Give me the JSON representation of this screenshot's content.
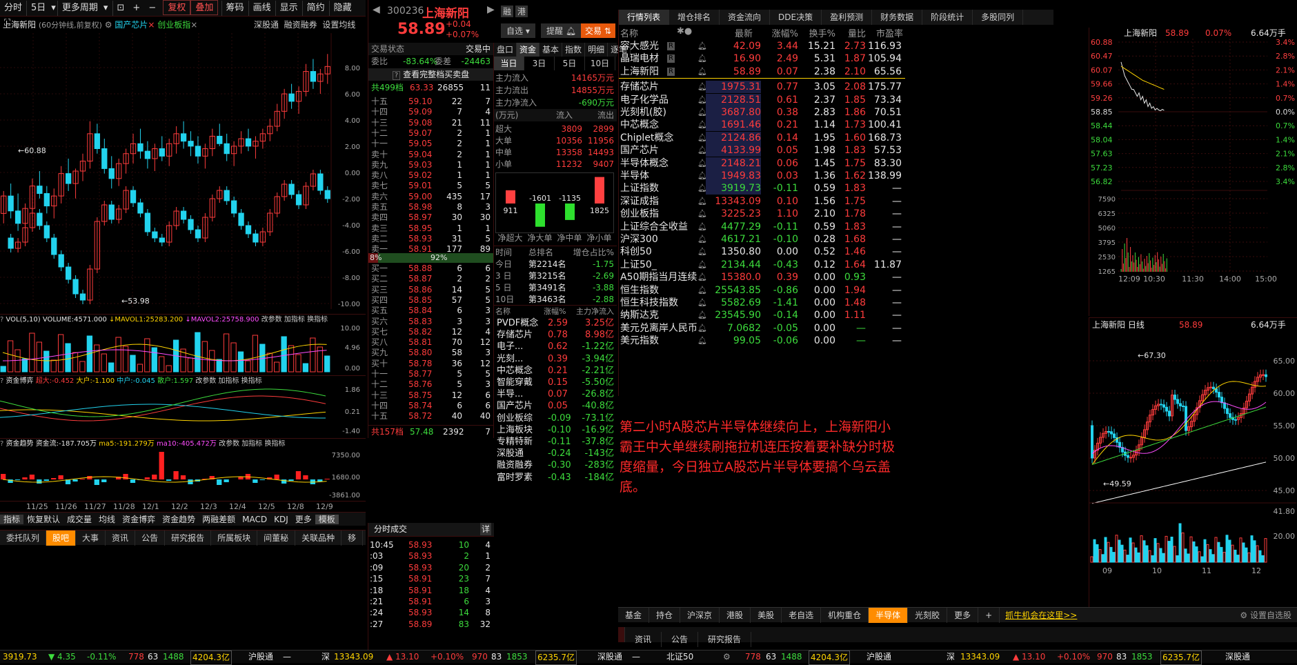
{
  "toolbar": {
    "items": [
      "分时",
      "5日",
      "更多周期",
      "复权",
      "叠加",
      "筹码",
      "画线",
      "显示",
      "简约",
      "隐藏"
    ]
  },
  "chart_header": {
    "stock": "上海新阳",
    "period": "(60分钟线,前复权)",
    "tag1": "国产芯片",
    "tag2": "创业板指",
    "links": [
      "深股通",
      "融资融券",
      "设置均线"
    ]
  },
  "kline": {
    "hi_label": "67.30",
    "lo_label": "53.98",
    "left_hi": "60.88",
    "y_ticks": [
      "8.00",
      "6.00",
      "4.00",
      "2.00",
      "0.00",
      "-2.00",
      "-4.00",
      "-6.00",
      "-8.00",
      "-10.00"
    ],
    "bars": [
      [
        57.2,
        58.1,
        56.8,
        57.9
      ],
      [
        57.9,
        58.4,
        57.0,
        57.3
      ],
      [
        57.3,
        58.0,
        56.5,
        56.8
      ],
      [
        56.8,
        57.6,
        56.3,
        57.4
      ],
      [
        57.4,
        58.6,
        57.1,
        58.3
      ],
      [
        58.3,
        58.9,
        57.8,
        58.0
      ],
      [
        58.0,
        58.3,
        57.2,
        57.5
      ],
      [
        57.5,
        58.2,
        57.0,
        57.9
      ],
      [
        57.9,
        59.1,
        57.6,
        58.8
      ],
      [
        58.8,
        59.4,
        58.1,
        58.4
      ],
      [
        58.4,
        59.0,
        57.8,
        58.9
      ],
      [
        58.9,
        59.6,
        58.5,
        59.3
      ],
      [
        59.3,
        60.9,
        59.0,
        60.4
      ],
      [
        60.4,
        60.8,
        59.6,
        59.8
      ],
      [
        59.8,
        60.2,
        58.8,
        59.0
      ],
      [
        59.0,
        59.5,
        58.2,
        58.6
      ],
      [
        58.6,
        59.4,
        58.3,
        59.2
      ],
      [
        59.2,
        59.8,
        58.8,
        59.6
      ],
      [
        59.6,
        60.4,
        59.2,
        60.0
      ],
      [
        60.0,
        60.6,
        59.4,
        59.7
      ],
      [
        59.7,
        60.1,
        59.0,
        59.4
      ],
      [
        59.4,
        60.0,
        58.9,
        59.8
      ],
      [
        59.8,
        60.3,
        59.3,
        59.5
      ],
      [
        59.5,
        60.2,
        59.1,
        60.0
      ],
      [
        60.0,
        60.7,
        59.6,
        60.4
      ],
      [
        60.4,
        60.9,
        59.8,
        60.1
      ],
      [
        60.1,
        60.5,
        59.5,
        59.9
      ],
      [
        59.9,
        60.3,
        59.2,
        59.5
      ],
      [
        59.5,
        60.0,
        59.0,
        59.8
      ],
      [
        59.8,
        60.6,
        59.5,
        60.3
      ],
      [
        60.3,
        60.8,
        59.9,
        60.0
      ],
      [
        60.0,
        60.4,
        59.3,
        59.6
      ],
      [
        59.6,
        60.1,
        59.1,
        59.9
      ],
      [
        59.9,
        60.5,
        59.6,
        60.2
      ],
      [
        60.2,
        60.6,
        59.7,
        59.9
      ],
      [
        59.9,
        60.3,
        59.4,
        60.1
      ],
      [
        60.1,
        60.6,
        59.8,
        60.4
      ],
      [
        60.4,
        61.0,
        60.1,
        60.7
      ],
      [
        60.7,
        61.6,
        60.5,
        61.3
      ],
      [
        61.3,
        62.2,
        61.0,
        62.0
      ],
      [
        62.0,
        62.4,
        61.4,
        61.7
      ],
      [
        61.7,
        62.3,
        61.2,
        62.1
      ],
      [
        62.1,
        63.2,
        61.9,
        62.9
      ],
      [
        62.9,
        63.4,
        62.2,
        62.5
      ],
      [
        62.5,
        63.0,
        62.0,
        62.8
      ],
      [
        62.8,
        63.6,
        62.4,
        63.1
      ]
    ]
  },
  "volume": {
    "header": "VOL(5,10)",
    "volume": "VOLUME:4571.000",
    "mavol1": "MAVOL1:25283.200",
    "mavol2": "MAVOL2:25758.900",
    "links": [
      "改参数",
      "加指标",
      "换指标"
    ],
    "ticks": [
      "10.00",
      "4.96",
      "0.00"
    ]
  },
  "capital_game": {
    "header": "资金博弈",
    "super": "超大:-0.452",
    "large": "大户:-1.100",
    "mid": "中户:-0.045",
    "retail": "散户:1.597",
    "links": [
      "改参数",
      "加指标",
      "换指标"
    ],
    "ticks": [
      "1.86",
      "0.21",
      "-1.40"
    ]
  },
  "capital_trend": {
    "header": "资金趋势",
    "flow": "资金流:-187.705万",
    "ma5": "ma5:-191.279万",
    "ma10": "ma10:-405.472万",
    "links": [
      "改参数",
      "加指标",
      "换指标"
    ],
    "ticks": [
      "7350.00",
      "1680.00",
      "-3861.00"
    ]
  },
  "date_axis": [
    "11/25",
    "11/26",
    "11/27",
    "11/28",
    "12/1",
    "12/2",
    "12/3",
    "12/4",
    "12/5",
    "12/8",
    "12/9"
  ],
  "indicator_tabs": [
    "指标",
    "恢复默认",
    "成交量",
    "均线",
    "资金博弈",
    "资金趋势",
    "两融差额",
    "MACD",
    "KDJ",
    "更多",
    "模板"
  ],
  "bottom_tabs": [
    "委托队列",
    "股吧",
    "大事",
    "资讯",
    "公告",
    "研究报告",
    "所属板块",
    "间董秘",
    "关联品种",
    "移"
  ],
  "quote": {
    "code": "300236",
    "name": "上海新阳",
    "price": "58.89",
    "chg": "+0.04",
    "pct": "+0.07%",
    "btns": [
      "融",
      "港",
      "自选",
      "提醒",
      "交易"
    ]
  },
  "order_book": {
    "status_label": "交易状态",
    "status": "交易中",
    "webi_label": "委比",
    "webi": "-83.64%",
    "wecha_label": "委差",
    "wecha": "-24463",
    "full_btn": "查看完整档买卖盘",
    "total_sell": "共499档",
    "total_sell_p": "63.33",
    "total_sell_v": "26855",
    "total_sell_n": "11",
    "sells": [
      [
        "十五",
        "59.10",
        "22",
        "7"
      ],
      [
        "十四",
        "59.09",
        "7",
        "4"
      ],
      [
        "十三",
        "59.08",
        "21",
        "11"
      ],
      [
        "十二",
        "59.07",
        "2",
        "1"
      ],
      [
        "十一",
        "59.05",
        "2",
        "1"
      ],
      [
        "卖十",
        "59.04",
        "2",
        "1"
      ],
      [
        "卖九",
        "59.03",
        "1",
        "1"
      ],
      [
        "卖八",
        "59.02",
        "1",
        "1"
      ],
      [
        "卖七",
        "59.01",
        "5",
        "5"
      ],
      [
        "卖六",
        "59.00",
        "435",
        "17"
      ],
      [
        "卖五",
        "58.98",
        "8",
        "3"
      ],
      [
        "卖四",
        "58.97",
        "30",
        "30"
      ],
      [
        "卖三",
        "58.95",
        "1",
        "1"
      ],
      [
        "卖二",
        "58.93",
        "31",
        "5"
      ],
      [
        "卖一",
        "58.91",
        "177",
        "89"
      ]
    ],
    "bar_l": "8%",
    "bar_r": "92%",
    "buys": [
      [
        "买一",
        "58.88",
        "6",
        "6"
      ],
      [
        "买二",
        "58.87",
        "2",
        "2"
      ],
      [
        "买三",
        "58.86",
        "14",
        "5"
      ],
      [
        "买四",
        "58.85",
        "57",
        "5"
      ],
      [
        "买五",
        "58.84",
        "6",
        "3"
      ],
      [
        "买六",
        "58.83",
        "3",
        "3"
      ],
      [
        "买七",
        "58.82",
        "12",
        "4"
      ],
      [
        "买八",
        "58.81",
        "70",
        "12"
      ],
      [
        "买九",
        "58.80",
        "58",
        "3"
      ],
      [
        "买十",
        "58.78",
        "36",
        "12"
      ],
      [
        "十一",
        "58.77",
        "5",
        "5"
      ],
      [
        "十二",
        "58.76",
        "5",
        "3"
      ],
      [
        "十三",
        "58.75",
        "12",
        "6"
      ],
      [
        "十四",
        "58.74",
        "6",
        "6"
      ],
      [
        "十五",
        "58.72",
        "40",
        "40"
      ]
    ],
    "total_buy": "共157档",
    "total_buy_p": "57.48",
    "total_buy_v": "2392",
    "total_buy_n": "7"
  },
  "ticks": {
    "title": "分时成交",
    "detail": "详",
    "rows": [
      [
        "10:45",
        "58.93",
        "10",
        "4"
      ],
      [
        ":03",
        "58.93",
        "2",
        "1"
      ],
      [
        ":09",
        "58.93",
        "20",
        "2"
      ],
      [
        ":15",
        "58.91",
        "23",
        "7"
      ],
      [
        ":18",
        "58.91",
        "18",
        "4"
      ],
      [
        ":21",
        "58.91",
        "6",
        "3"
      ],
      [
        ":24",
        "58.93",
        "14",
        "8"
      ],
      [
        ":27",
        "58.89",
        "83",
        "32"
      ]
    ]
  },
  "funds": {
    "tabs": [
      "盘口",
      "资金",
      "基本",
      "指数",
      "明细",
      "逐笔"
    ],
    "periods": [
      "当日",
      "3日",
      "5日",
      "10日"
    ],
    "in_l": "主力流入",
    "in_v": "14165万元",
    "out_l": "主力流出",
    "out_v": "14855万元",
    "net_l": "主力净流入",
    "net_v": "-690万元",
    "unit": "(万元)",
    "col_in": "流入",
    "col_out": "流出",
    "rows": [
      [
        "超大",
        "3809",
        "2899"
      ],
      [
        "大单",
        "10356",
        "11956"
      ],
      [
        "中单",
        "13358",
        "14493"
      ],
      [
        "小单",
        "11232",
        "9407"
      ]
    ],
    "bars": [
      911,
      -1601,
      -1135,
      1825
    ],
    "bar_labels": [
      "911",
      "-1601",
      "-1135",
      "1825"
    ],
    "bar_names": [
      "净超大",
      "净大单",
      "净中单",
      "净小单"
    ],
    "rank_h": [
      "时间",
      "总排名",
      "增仓占比%"
    ],
    "rank": [
      [
        "今日",
        "第2214名",
        "-1.75"
      ],
      [
        "3 日",
        "第3215名",
        "-2.69"
      ],
      [
        "5 日",
        "第3491名",
        "-3.88"
      ],
      [
        "10日",
        "第3463名",
        "-2.88"
      ]
    ],
    "sec_h": [
      "名称",
      "涨幅%",
      "主力净流入"
    ],
    "sectors": [
      [
        "PVDF概念",
        "2.59",
        "3.25亿"
      ],
      [
        "存储芯片",
        "0.78",
        "8.98亿"
      ],
      [
        "电子...",
        "0.62",
        "-1.22亿"
      ],
      [
        "光刻...",
        "0.39",
        "-3.94亿"
      ],
      [
        "中芯概念",
        "0.21",
        "-2.21亿"
      ],
      [
        "智能穿戴",
        "0.15",
        "-5.50亿"
      ],
      [
        "半导...",
        "0.07",
        "-26.8亿"
      ],
      [
        "国产芯片",
        "0.05",
        "-40.8亿"
      ],
      [
        "创业板综",
        "-0.09",
        "-73.1亿"
      ],
      [
        "上海板块",
        "-0.10",
        "-16.9亿"
      ],
      [
        "专精特新",
        "-0.11",
        "-37.8亿"
      ],
      [
        "深股通",
        "-0.24",
        "-143亿"
      ],
      [
        "融资融券",
        "-0.30",
        "-283亿"
      ],
      [
        "富时罗素",
        "-0.43",
        "-184亿"
      ]
    ]
  },
  "watch": {
    "tabs": [
      "行情列表",
      "增仓排名",
      "资金流向",
      "DDE决策",
      "盈利预测",
      "财务数据",
      "阶段统计",
      "多股同列"
    ],
    "cols": [
      "名称",
      "最新",
      "涨幅%",
      "换手%",
      "量比",
      "市盈率"
    ],
    "rows": [
      [
        "容大感光",
        "42.09",
        "3.44",
        "15.21",
        "2.73",
        "116.93"
      ],
      [
        "晶瑞电材",
        "16.90",
        "2.49",
        "5.31",
        "1.87",
        "105.94"
      ],
      [
        "上海新阳",
        "58.89",
        "0.07",
        "2.38",
        "2.10",
        "65.56"
      ],
      [
        "存储芯片",
        "1975.31",
        "0.77",
        "3.05",
        "2.08",
        "175.77"
      ],
      [
        "电子化学品",
        "2128.51",
        "0.61",
        "2.37",
        "1.85",
        "73.34"
      ],
      [
        "光刻机(胶)",
        "3687.80",
        "0.38",
        "2.83",
        "1.86",
        "70.51"
      ],
      [
        "中芯概念",
        "1691.46",
        "0.21",
        "1.14",
        "1.73",
        "100.41"
      ],
      [
        "Chiplet概念",
        "2124.86",
        "0.14",
        "1.95",
        "1.60",
        "168.73"
      ],
      [
        "国产芯片",
        "4133.99",
        "0.05",
        "1.98",
        "1.83",
        "57.53"
      ],
      [
        "半导体概念",
        "2148.21",
        "0.06",
        "1.45",
        "1.75",
        "83.30"
      ],
      [
        "半导体",
        "1949.83",
        "0.03",
        "1.36",
        "1.62",
        "138.99"
      ],
      [
        "上证指数",
        "3919.73",
        "-0.11",
        "0.59",
        "1.83",
        "—"
      ],
      [
        "深证成指",
        "13343.09",
        "0.10",
        "1.56",
        "1.75",
        "—"
      ],
      [
        "创业板指",
        "3225.23",
        "1.10",
        "2.10",
        "1.78",
        "—"
      ],
      [
        "上证综合全收益",
        "4477.29",
        "-0.11",
        "0.59",
        "1.83",
        "—"
      ],
      [
        "沪深300",
        "4617.21",
        "-0.10",
        "0.28",
        "1.68",
        "—"
      ],
      [
        "科创50",
        "1350.80",
        "0.00",
        "0.52",
        "1.46",
        "—"
      ],
      [
        "上证50_",
        "2134.44",
        "-0.43",
        "0.12",
        "1.64",
        "11.87"
      ],
      [
        "A50期指当月连续",
        "15380.0",
        "0.39",
        "0.00",
        "0.93",
        "—"
      ],
      [
        "恒生指数",
        "25543.85",
        "-0.86",
        "0.00",
        "1.94",
        "—"
      ],
      [
        "恒生科技指数",
        "5582.69",
        "-1.41",
        "0.00",
        "1.48",
        "—"
      ],
      [
        "纳斯达克",
        "23545.90",
        "-0.14",
        "0.00",
        "1.11",
        "—"
      ],
      [
        "美元兑离岸人民币",
        "7.0682",
        "-0.05",
        "0.00",
        "—",
        "—"
      ],
      [
        "美元指数",
        "99.05",
        "-0.06",
        "0.00",
        "—",
        "—"
      ]
    ]
  },
  "note": "第二小时A股芯片半导体继续向上，上海新阳小霸王中大单继续刷拖拉机连压按着要补缺分时极度缩量，今日独立A股芯片半导体要搞个乌云盖底。",
  "list_tabs": [
    "基金",
    "持仓",
    "沪深京",
    "港股",
    "美股",
    "老自选",
    "机构重仓",
    "半导体",
    "光刻胶",
    "更多",
    "+"
  ],
  "promo": "抓牛机会在这里>>",
  "settings": "设置自选股",
  "mini_tabs": [
    "资讯",
    "公告",
    "研究报告"
  ],
  "intraday": {
    "name": "上海新阳",
    "price": "58.89",
    "pct": "0.07%",
    "amt": "6.64万手",
    "left": [
      "60.88",
      "60.47",
      "60.07",
      "59.66",
      "59.26",
      "58.85",
      "58.44",
      "58.04",
      "57.63",
      "57.23",
      "56.82"
    ],
    "right": [
      "3.4%",
      "2.8%",
      "2.1%",
      "1.4%",
      "0.7%",
      "0.0%",
      "0.7%",
      "1.4%",
      "2.1%",
      "2.8%",
      "3.4%"
    ],
    "vol": [
      "7590",
      "6325",
      "5060",
      "3795",
      "2530",
      "1265"
    ],
    "times": [
      "12:09",
      "10:30",
      "11:30",
      "14:00",
      "15:00"
    ],
    "line": [
      60.3,
      60.1,
      59.9,
      59.8,
      59.7,
      59.6,
      59.5,
      59.5,
      59.4,
      59.3,
      59.4,
      59.2,
      59.3,
      59.1,
      59.2,
      59.0,
      59.1,
      58.95,
      59.0,
      58.9,
      58.95,
      58.9,
      58.88,
      58.92,
      58.89
    ]
  },
  "daily": {
    "name": "上海新阳 日线",
    "price": "58.89",
    "amt": "6.64万手",
    "hi": "67.30",
    "lo": "49.59",
    "y": [
      "65.00",
      "60.00",
      "55.00",
      "50.00",
      "45.00"
    ],
    "vol": [
      "41.80",
      "20.00"
    ],
    "months": [
      "09",
      "10",
      "11",
      "12"
    ]
  },
  "status": {
    "sh": "3919.73",
    "sh_chg": "▼ 4.35",
    "sh_pct": "-0.11%",
    "a": "778",
    "b": "63",
    "c": "1488",
    "amt": "4204.3亿",
    "hgt": "沪股通",
    "sz_l": "深",
    "sz": "13343.09",
    "sz_chg": "▲ 13.10",
    "sz_pct": "+0.10%",
    "d": "970",
    "e": "83",
    "f": "1853",
    "samt": "6235.7亿",
    "sgt": "深股通",
    "kc": "北证50"
  }
}
